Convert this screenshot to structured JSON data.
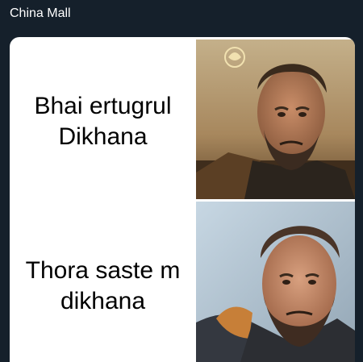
{
  "header": {
    "title": "China Mall"
  },
  "meme": {
    "top_text": "Bhai ertugrul Dikhana",
    "bottom_text": "Thora saste m dikhana"
  }
}
